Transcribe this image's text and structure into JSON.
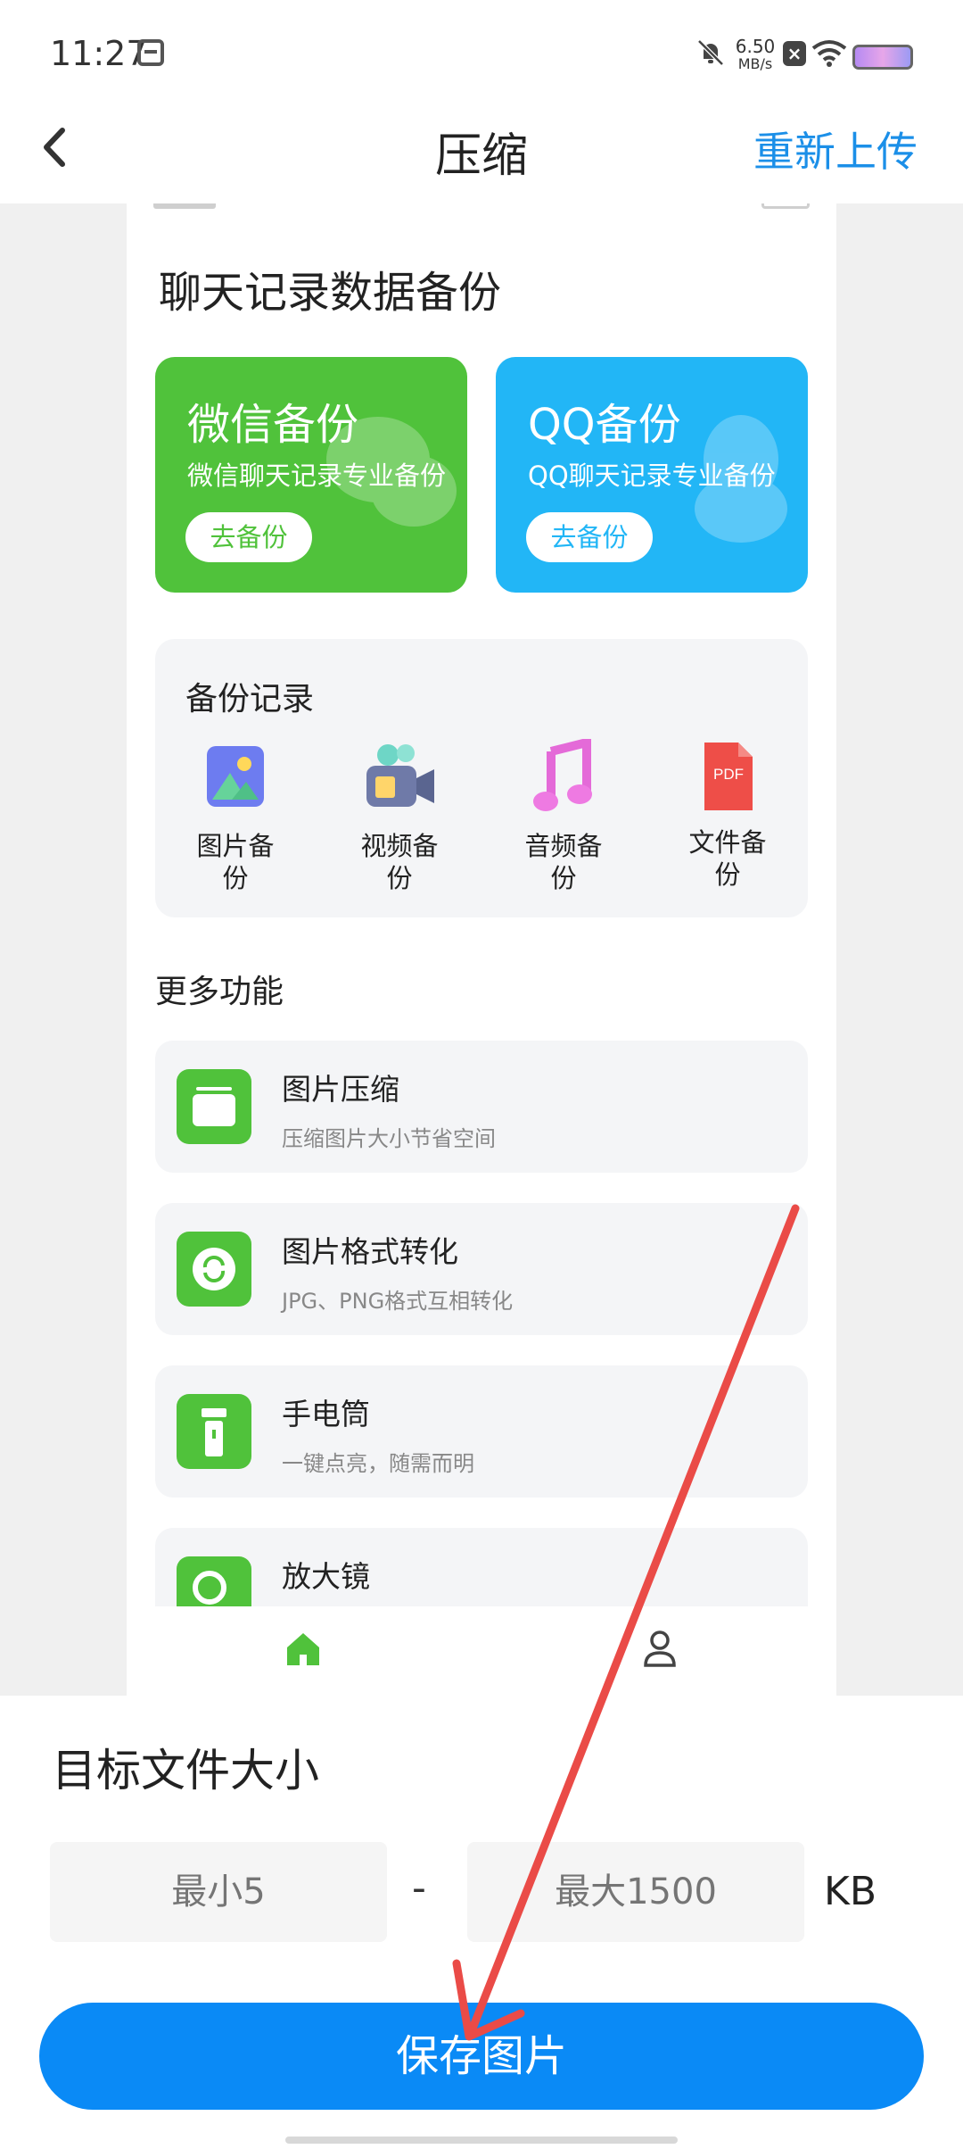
{
  "status_bar": {
    "time": "11:27",
    "net_speed_value": "6.50",
    "net_speed_unit": "MB/s"
  },
  "header": {
    "title": "压缩",
    "reupload_label": "重新上传"
  },
  "preview": {
    "section_title": "聊天记录数据备份",
    "cards": [
      {
        "title": "微信备份",
        "subtitle": "微信聊天记录专业备份",
        "button": "去备份",
        "color": "#50c23b"
      },
      {
        "title": "QQ备份",
        "subtitle": "QQ聊天记录专业备份",
        "button": "去备份",
        "color": "#22b6f6"
      }
    ],
    "backup_records": {
      "title": "备份记录",
      "items": [
        {
          "label": "图片备份",
          "icon": "picture-icon"
        },
        {
          "label": "视频备份",
          "icon": "video-camera-icon"
        },
        {
          "label": "音频备份",
          "icon": "music-note-icon"
        },
        {
          "label": "文件备份",
          "icon": "pdf-file-icon"
        }
      ]
    },
    "more_features": {
      "title": "更多功能",
      "items": [
        {
          "title": "图片压缩",
          "subtitle": "压缩图片大小节省空间",
          "icon": "compress-icon"
        },
        {
          "title": "图片格式转化",
          "subtitle": "JPG、PNG格式互相转化",
          "icon": "convert-icon"
        },
        {
          "title": "手电筒",
          "subtitle": "一键点亮，随需而明",
          "icon": "flashlight-icon"
        },
        {
          "title": "放大镜",
          "subtitle": "",
          "icon": "magnifier-icon"
        }
      ]
    },
    "pdf_badge": "PDF"
  },
  "target_size": {
    "title": "目标文件大小",
    "min_placeholder": "最小5",
    "max_placeholder": "最大1500",
    "separator": "-",
    "unit": "KB"
  },
  "save_button": "保存图片",
  "colors": {
    "accent": "#0a8af6",
    "link": "#1b8fe8",
    "green": "#50c23b",
    "annotation_arrow": "#ea4b47"
  }
}
